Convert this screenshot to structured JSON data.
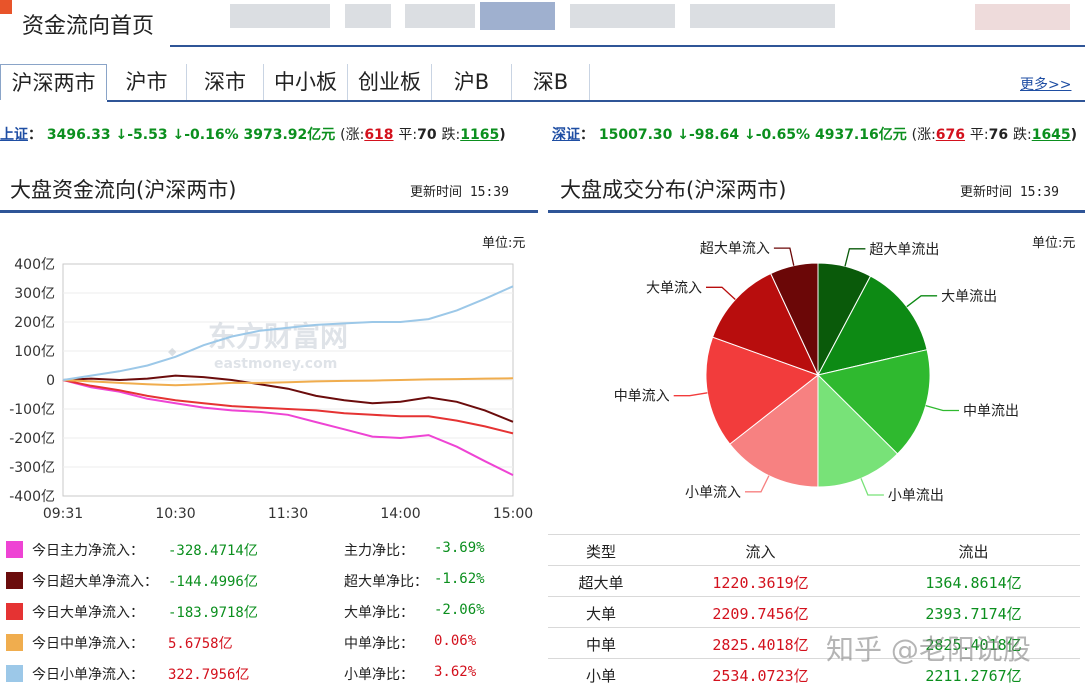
{
  "header": {
    "title": "资金流向首页"
  },
  "tabs": [
    "沪深两市",
    "沪市",
    "深市",
    "中小板",
    "创业板",
    "沪B",
    "深B"
  ],
  "more_link": "更多>>",
  "market": {
    "sh": {
      "name": "上证",
      "index": "3496.33",
      "change": "↓-5.53",
      "pct": "↓-0.16%",
      "amount": "3973.92亿元",
      "up_label": "(涨:",
      "up": "618",
      "flat_label": "平:",
      "flat": "70",
      "down_label": "跌:",
      "down": "1165",
      "close": ")"
    },
    "sz": {
      "name": "深证",
      "index": "15007.30",
      "change": "↓-98.64",
      "pct": "↓-0.65%",
      "amount": "4937.16亿元",
      "up_label": "(涨:",
      "up": "676",
      "flat_label": "平:",
      "flat": "76",
      "down_label": "跌:",
      "down": "1645",
      "close": ")"
    }
  },
  "left_panel": {
    "title": "大盘资金流向(沪深两市)",
    "update": "更新时间 15:39",
    "unit": "单位:元"
  },
  "right_panel": {
    "title": "大盘成交分布(沪深两市)",
    "update": "更新时间 15:39",
    "unit": "单位:元"
  },
  "watermark": {
    "cn": "东方财富网",
    "en": "eastmoney.com"
  },
  "chart_data": [
    {
      "type": "line",
      "x_ticks": [
        "09:31",
        "10:30",
        "11:30",
        "14:00",
        "15:00"
      ],
      "y_ticks": [
        "400亿",
        "300亿",
        "200亿",
        "100亿",
        "0",
        "-100亿",
        "-200亿",
        "-300亿",
        "-400亿"
      ],
      "ylim": [
        -400,
        400
      ],
      "series": [
        {
          "name": "今日主力净流入",
          "color": "#ee44d4",
          "values": [
            0,
            -25,
            -40,
            -65,
            -80,
            -95,
            -105,
            -110,
            -120,
            -145,
            -170,
            -195,
            -200,
            -190,
            -230,
            -280,
            -328
          ]
        },
        {
          "name": "今日超大单净流入",
          "color": "#6b0c0c",
          "values": [
            0,
            5,
            0,
            5,
            15,
            10,
            0,
            -15,
            -30,
            -55,
            -70,
            -80,
            -75,
            -60,
            -75,
            -105,
            -144
          ]
        },
        {
          "name": "今日大单净流入",
          "color": "#e53333",
          "values": [
            0,
            -20,
            -35,
            -55,
            -70,
            -80,
            -90,
            -95,
            -100,
            -105,
            -115,
            -120,
            -125,
            -125,
            -140,
            -160,
            -184
          ]
        },
        {
          "name": "今日中单净流入",
          "color": "#f0ad4e",
          "values": [
            0,
            -5,
            -10,
            -15,
            -18,
            -15,
            -10,
            -10,
            -8,
            -5,
            -3,
            -2,
            0,
            2,
            3,
            5,
            6
          ]
        },
        {
          "name": "今日小单净流入",
          "color": "#9cc8e8",
          "values": [
            0,
            15,
            30,
            50,
            80,
            120,
            150,
            170,
            180,
            190,
            195,
            200,
            200,
            210,
            240,
            280,
            323
          ]
        }
      ]
    },
    {
      "type": "pie",
      "slices": [
        {
          "label": "超大单流出",
          "value": 1364.8614,
          "color": "#0a5a0a"
        },
        {
          "label": "大单流出",
          "value": 2393.7174,
          "color": "#0d8a14"
        },
        {
          "label": "中单流出",
          "value": 2825.4018,
          "color": "#2fb92f"
        },
        {
          "label": "小单流出",
          "value": 2211.2767,
          "color": "#78e278"
        },
        {
          "label": "小单流入",
          "value": 2534.0723,
          "color": "#f78181"
        },
        {
          "label": "中单流入",
          "value": 2825.4018,
          "color": "#f23c3c"
        },
        {
          "label": "大单流入",
          "value": 2209.7456,
          "color": "#b80d0d"
        },
        {
          "label": "超大单流入",
          "value": 1220.3619,
          "color": "#6b0707"
        }
      ]
    }
  ],
  "legend": [
    {
      "label": "今日主力净流入：",
      "value": "-328.4714亿",
      "ratio_label": "主力净比：",
      "ratio": "-3.69%",
      "color": "#ee44d4",
      "sign": "neg"
    },
    {
      "label": "今日超大单净流入：",
      "value": "-144.4996亿",
      "ratio_label": "超大单净比：",
      "ratio": "-1.62%",
      "color": "#6b0c0c",
      "sign": "neg"
    },
    {
      "label": "今日大单净流入：",
      "value": "-183.9718亿",
      "ratio_label": "大单净比：",
      "ratio": "-2.06%",
      "color": "#e53333",
      "sign": "neg"
    },
    {
      "label": "今日中单净流入：",
      "value": "5.6758亿",
      "ratio_label": "中单净比：",
      "ratio": "0.06%",
      "color": "#f0ad4e",
      "sign": "pos"
    },
    {
      "label": "今日小单净流入：",
      "value": "322.7956亿",
      "ratio_label": "小单净比：",
      "ratio": "3.62%",
      "color": "#9cc8e8",
      "sign": "pos"
    }
  ],
  "table": {
    "headers": [
      "类型",
      "流入",
      "流出"
    ],
    "rows": [
      {
        "type": "超大单",
        "in": "1220.3619亿",
        "out": "1364.8614亿"
      },
      {
        "type": "大单",
        "in": "2209.7456亿",
        "out": "2393.7174亿"
      },
      {
        "type": "中单",
        "in": "2825.4018亿",
        "out": "2825.4018亿"
      },
      {
        "type": "小单",
        "in": "2534.0723亿",
        "out": "2211.2767亿"
      }
    ]
  },
  "overlay_watermark": "知乎 @老阳说股"
}
